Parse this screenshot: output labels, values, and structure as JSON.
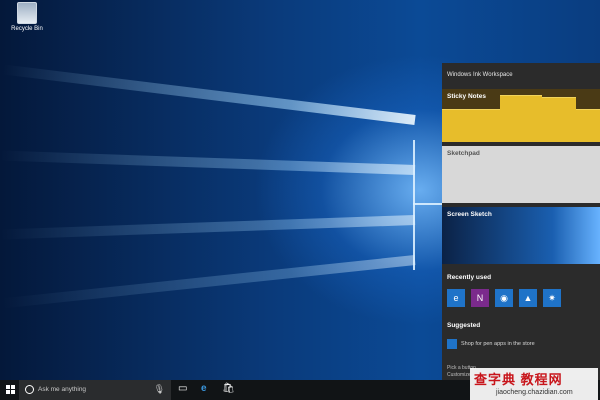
{
  "desktop": {
    "recycle_bin_label": "Recycle Bin"
  },
  "ink_workspace": {
    "title": "Windows Ink Workspace",
    "tiles": {
      "sticky_notes": "Sticky Notes",
      "sketchpad": "Sketchpad",
      "screen_sketch": "Screen Sketch"
    },
    "recently_used_label": "Recently used",
    "recent_apps": [
      {
        "icon": "edge-icon",
        "glyph": "e"
      },
      {
        "icon": "onenote-icon",
        "glyph": "N"
      },
      {
        "icon": "maps-icon",
        "glyph": "◉"
      },
      {
        "icon": "photos-icon",
        "glyph": "▲"
      },
      {
        "icon": "tips-icon",
        "glyph": "✷"
      }
    ],
    "suggested_label": "Suggested",
    "suggestion": "Shop for pen apps in the store",
    "footer_line1": "Pick a button",
    "footer_line2": "Customize"
  },
  "taskbar": {
    "search_placeholder": "Ask me anything",
    "icons": [
      "start-icon",
      "task-view-icon",
      "edge-icon",
      "store-icon"
    ]
  },
  "watermark": {
    "brand": "查字典 教程网",
    "url": "jiaocheng.chazidian.com"
  },
  "colors": {
    "sticky": "#e7bd2b",
    "accent": "#1f73c8",
    "panel": "#2b2b2b",
    "taskbar": "#111416"
  }
}
